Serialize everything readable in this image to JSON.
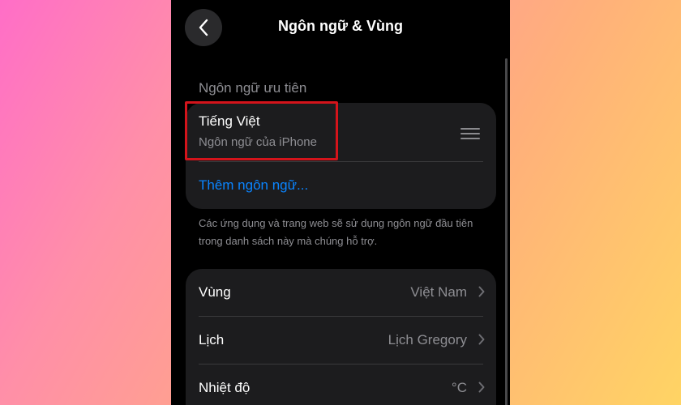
{
  "nav": {
    "title": "Ngôn ngữ & Vùng",
    "back_icon": "chevron-left-icon"
  },
  "preferred_languages": {
    "header": "Ngôn ngữ ưu tiên",
    "items": [
      {
        "title": "Tiếng Việt",
        "subtitle": "Ngôn ngữ của iPhone"
      }
    ],
    "add_label": "Thêm ngôn ngữ...",
    "footer": "Các ứng dụng và trang web sẽ sử dụng ngôn ngữ đầu tiên trong danh sách này mà chúng hỗ trợ."
  },
  "settings": {
    "rows": [
      {
        "label": "Vùng",
        "value": "Việt Nam"
      },
      {
        "label": "Lịch",
        "value": "Lịch Gregory"
      },
      {
        "label": "Nhiệt độ",
        "value": "°C"
      }
    ]
  },
  "colors": {
    "accent": "#0a84ff",
    "highlight": "#d4141b",
    "card": "#1c1c1e",
    "secondary_text": "#8e8e93"
  }
}
